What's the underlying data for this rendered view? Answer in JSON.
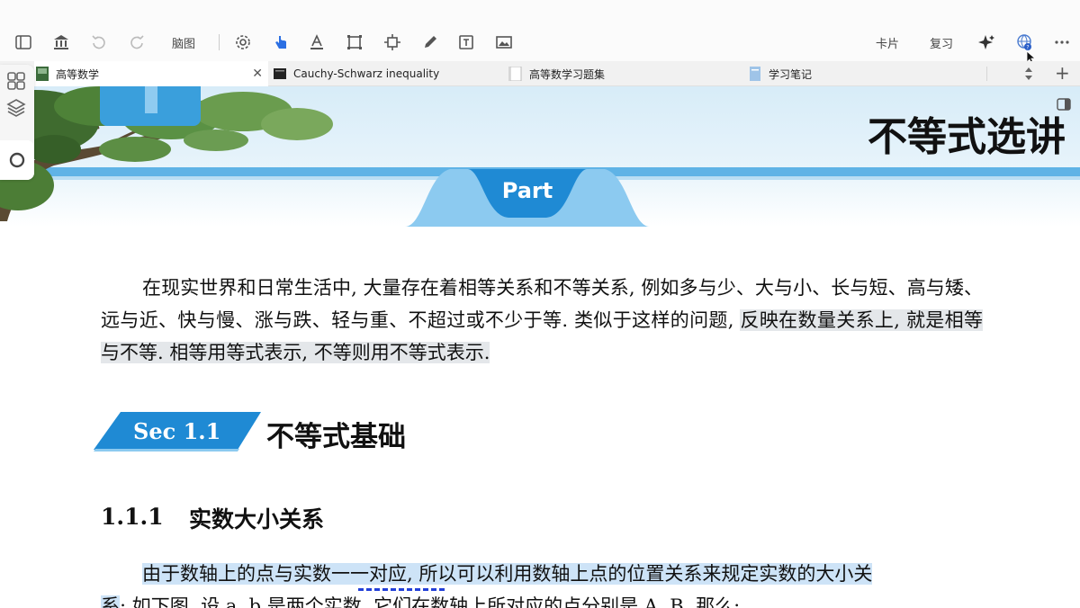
{
  "toolbar": {
    "mindmap_label": "脑图",
    "card_label": "卡片",
    "review_label": "复习"
  },
  "tabs": [
    {
      "label": "高等数学",
      "active": true,
      "closable": true
    },
    {
      "label": "Cauchy-Schwarz inequality",
      "active": false
    },
    {
      "label": "高等数学习题集",
      "active": false
    },
    {
      "label": "学习笔记",
      "active": false
    }
  ],
  "tabbar": {
    "add_label": "+"
  },
  "document": {
    "banner_title": "不等式选讲",
    "part_label": "Part",
    "intro_paragraph_part1": "在现实世界和日常生活中, 大量存在着相等关系和不等关系, 例如多与少、大与小、长与短、高与矮、远与近、快与慢、涨与跌、轻与重、不超过或不少于等. 类似于这样的问题, ",
    "intro_paragraph_highlight": "反映在数量关系上, 就是相等与不等. 相等用等式表示, 不等则用不等式表示.",
    "section_label": "Sec 1.1",
    "section_title": "不等式基础",
    "subsection_number": "1.1.1",
    "subsection_title": "实数大小关系",
    "body_line1_highlight": "由于数轴上的点与实数一一对应, 所以可以利用数轴上点的位置关系来规定实数的大小关",
    "body_line2_start": "系",
    "body_line2_rest": ": 如下图, 设 a, b 是两个实数, 它们在数轴上所对应的点分别是 A, B. 那么:"
  },
  "colors": {
    "accent_blue": "#3a9fdc",
    "highlight_blue": "#cde3f7",
    "highlight_gray": "#e4e7ea",
    "active_tool": "#2b6fe3"
  }
}
